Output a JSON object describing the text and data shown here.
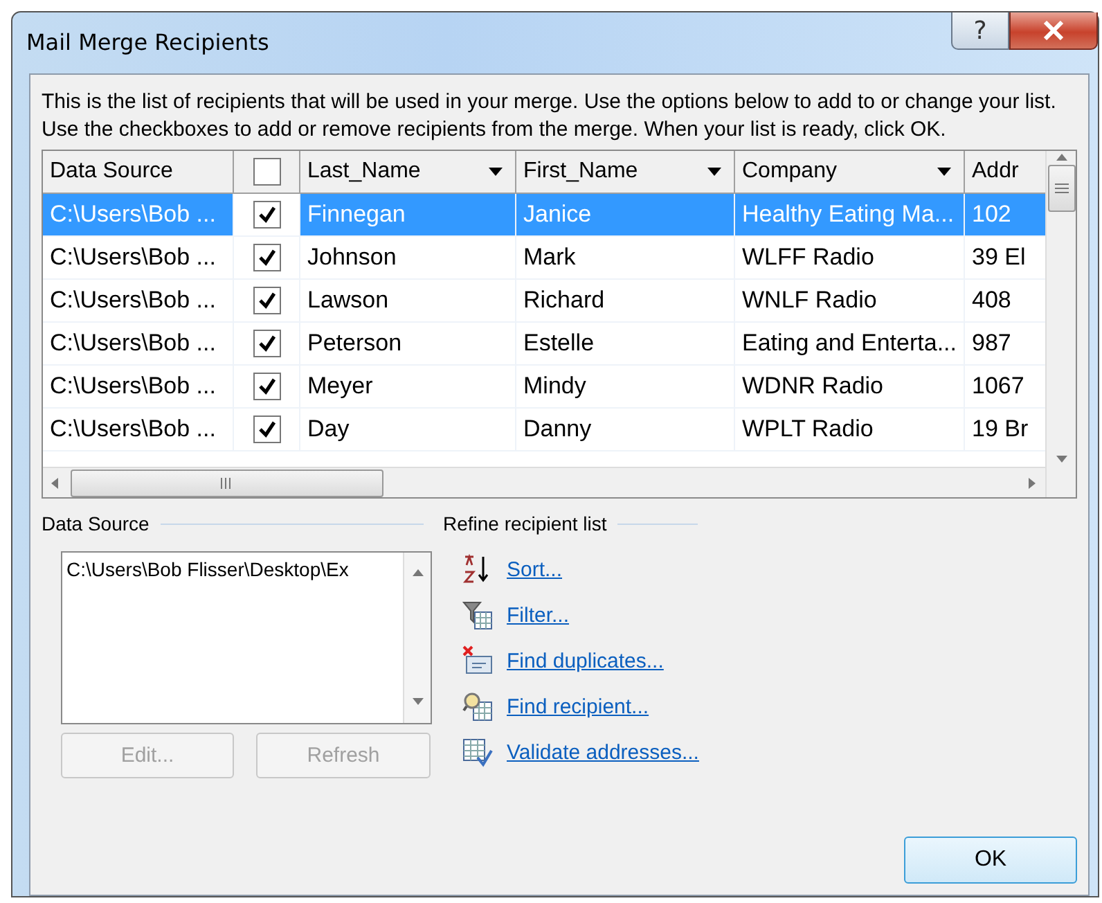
{
  "window": {
    "title": "Mail Merge Recipients",
    "help_button": "?"
  },
  "intro": "This is the list of recipients that will be used in your merge.  Use the options below to add to or change your list.  Use the checkboxes to add or remove recipients from the merge.  When your list is ready, click OK.",
  "table": {
    "select_all_checked": false,
    "columns": [
      {
        "label": "Data Source",
        "dropdown": false
      },
      {
        "label": "Last_Name",
        "dropdown": true
      },
      {
        "label": "First_Name",
        "dropdown": true
      },
      {
        "label": "Company",
        "dropdown": true
      },
      {
        "label": "Addr",
        "dropdown": false
      }
    ],
    "rows": [
      {
        "selected": true,
        "checked": true,
        "cells": [
          "C:\\Users\\Bob ...",
          "Finnegan",
          "Janice",
          "Healthy Eating Ma...",
          "102"
        ]
      },
      {
        "selected": false,
        "checked": true,
        "cells": [
          "C:\\Users\\Bob ...",
          "Johnson",
          "Mark",
          "WLFF Radio",
          "39 El"
        ]
      },
      {
        "selected": false,
        "checked": true,
        "cells": [
          "C:\\Users\\Bob ...",
          "Lawson",
          "Richard",
          "WNLF Radio",
          "408"
        ]
      },
      {
        "selected": false,
        "checked": true,
        "cells": [
          "C:\\Users\\Bob ...",
          "Peterson",
          "Estelle",
          "Eating and Enterta...",
          "987"
        ]
      },
      {
        "selected": false,
        "checked": true,
        "cells": [
          "C:\\Users\\Bob ...",
          "Meyer",
          "Mindy",
          "WDNR Radio",
          "1067"
        ]
      },
      {
        "selected": false,
        "checked": true,
        "cells": [
          "C:\\Users\\Bob ...",
          "Day",
          "Danny",
          "WPLT Radio",
          "19 Br"
        ]
      }
    ]
  },
  "data_source": {
    "heading": "Data Source",
    "items": [
      "C:\\Users\\Bob Flisser\\Desktop\\Ex"
    ],
    "buttons": [
      {
        "label": "Edit...",
        "disabled": true
      },
      {
        "label": "Refresh",
        "disabled": true
      }
    ]
  },
  "refine": {
    "heading": "Refine recipient list",
    "links": [
      {
        "kind": "sort",
        "label": "Sort..."
      },
      {
        "kind": "filter",
        "label": "Filter..."
      },
      {
        "kind": "duplicates",
        "label": "Find duplicates..."
      },
      {
        "kind": "find",
        "label": "Find recipient..."
      },
      {
        "kind": "validate",
        "label": "Validate addresses..."
      }
    ]
  },
  "buttons": [
    {
      "label": "OK"
    }
  ]
}
